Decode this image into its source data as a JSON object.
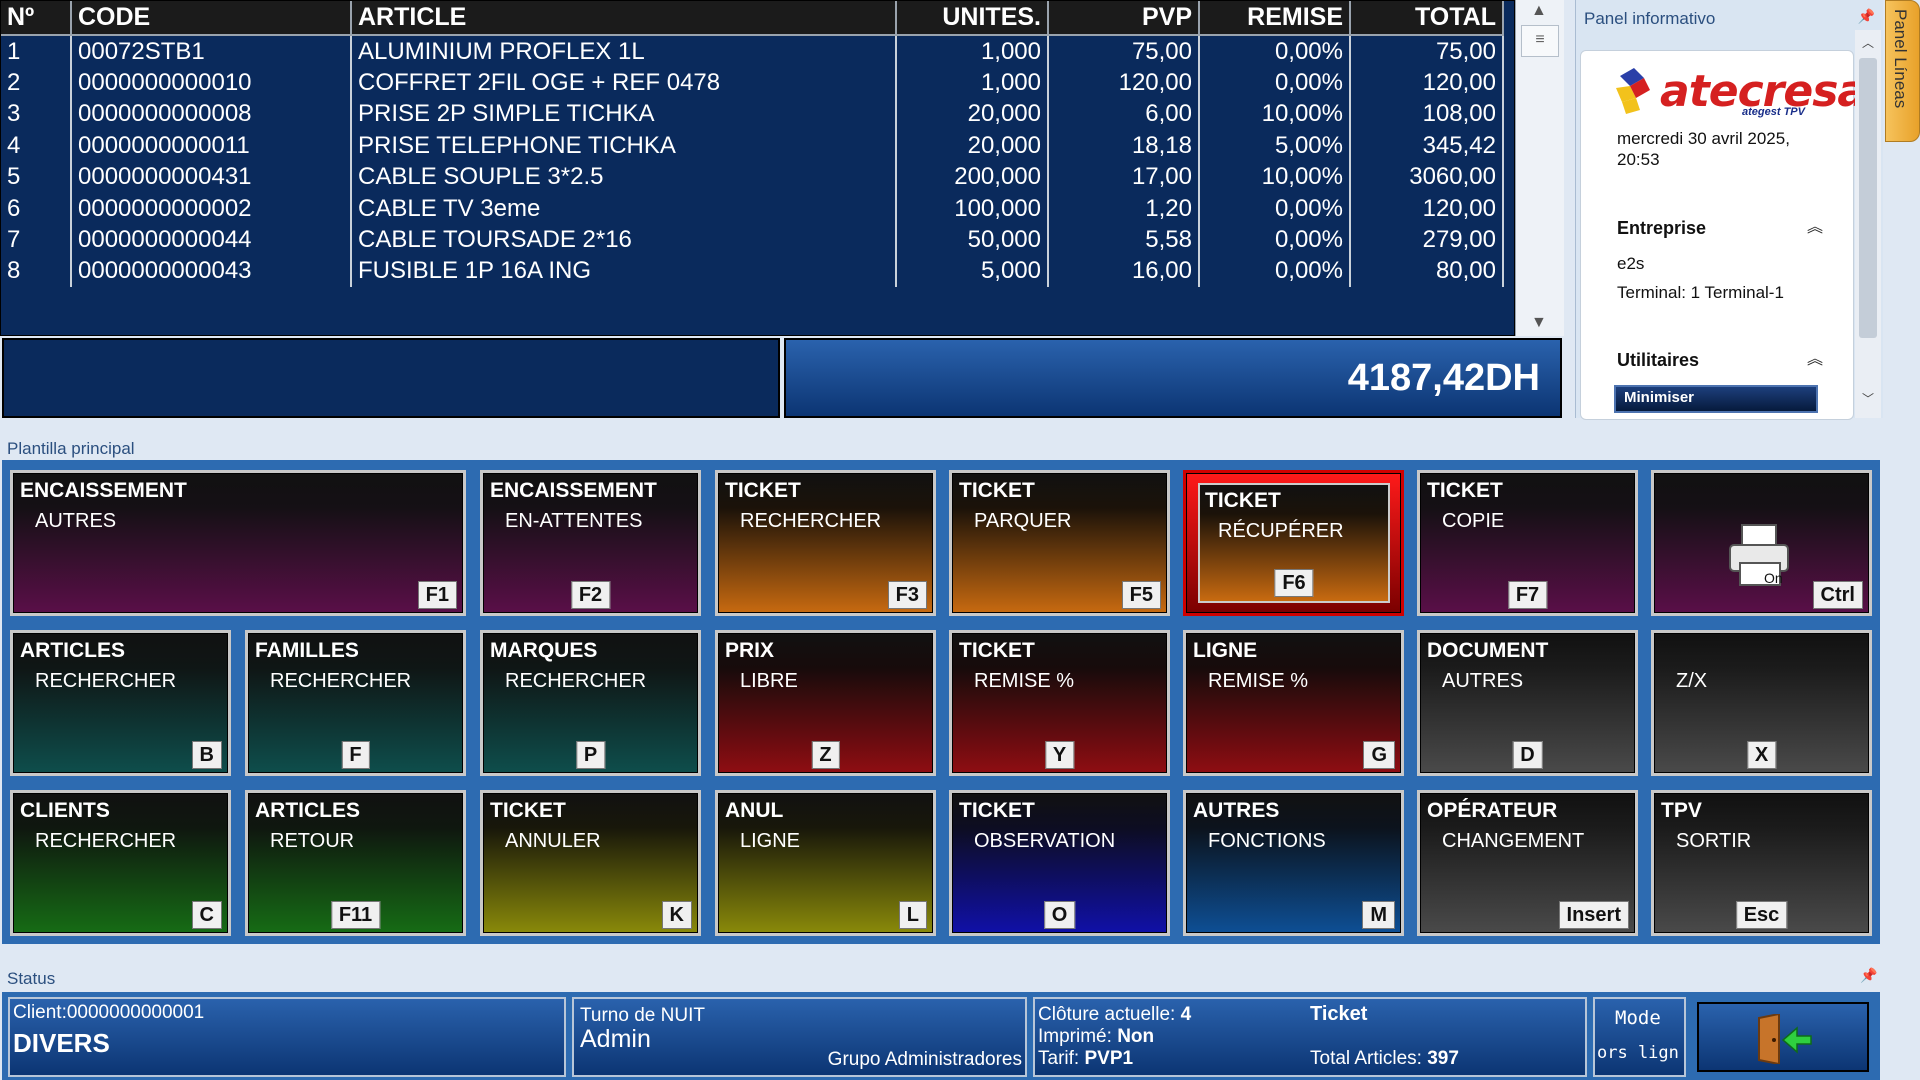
{
  "grid": {
    "columns": [
      "Nº",
      "CODE",
      "ARTICLE",
      "UNITES.",
      "PVP",
      "REMISE",
      "TOTAL"
    ],
    "rows": [
      [
        "1",
        "00072STB1",
        "ALUMINIUM PROFLEX 1L",
        "1,000",
        "75,00",
        "0,00%",
        "75,00"
      ],
      [
        "2",
        "0000000000010",
        "COFFRET 2FIL OGE    + REF 0478",
        "1,000",
        "120,00",
        "0,00%",
        "120,00"
      ],
      [
        "3",
        "0000000000008",
        "PRISE 2P SIMPLE TICHKA",
        "20,000",
        "6,00",
        "10,00%",
        "108,00"
      ],
      [
        "4",
        "0000000000011",
        "PRISE TELEPHONE TICHKA",
        "20,000",
        "18,18",
        "5,00%",
        "345,42"
      ],
      [
        "5",
        "0000000000431",
        "CABLE SOUPLE 3*2.5",
        "200,000",
        "17,00",
        "10,00%",
        "3060,00"
      ],
      [
        "6",
        "0000000000002",
        "CABLE TV 3eme",
        "100,000",
        "1,20",
        "0,00%",
        "120,00"
      ],
      [
        "7",
        "0000000000044",
        "CABLE TOURSADE 2*16",
        "50,000",
        "5,58",
        "0,00%",
        "279,00"
      ],
      [
        "8",
        "0000000000043",
        "FUSIBLE 1P 16A ING",
        "5,000",
        "16,00",
        "0,00%",
        "80,00"
      ]
    ],
    "total": "4187,42DH"
  },
  "info_panel": {
    "title": "Panel informativo",
    "side_tab": "Panel Líneas",
    "logo": "atecresa",
    "logo_sub": "ategest TPV",
    "date": "mercredi 30 avril 2025, 20:53",
    "entreprise_label": "Entreprise",
    "entreprise_value": "e2s",
    "terminal": "Terminal: 1 Terminal-1",
    "utilitaires_label": "Utilitaires",
    "minimize_label": "Minimiser"
  },
  "plantilla": {
    "title": "Plantilla principal",
    "buttons": [
      {
        "l1": "ENCAISSEMENT",
        "l2": "AUTRES",
        "key": "F1"
      },
      {
        "l1": "ENCAISSEMENT",
        "l2": "EN-ATTENTES",
        "key": "F2"
      },
      {
        "l1": "TICKET",
        "l2": "RECHERCHER",
        "key": "F3"
      },
      {
        "l1": "TICKET",
        "l2": "PARQUER",
        "key": "F5"
      },
      {
        "l1": "TICKET",
        "l2": "RÉCUPÉRER",
        "key": "F6"
      },
      {
        "l1": "TICKET",
        "l2": "COPIE",
        "key": "F7"
      },
      {
        "l1": "",
        "l2": "",
        "key": "Ctrl",
        "icon": "printer-icon"
      },
      {
        "l1": "ARTICLES",
        "l2": "RECHERCHER",
        "key": "B"
      },
      {
        "l1": "FAMILLES",
        "l2": "RECHERCHER",
        "key": "F"
      },
      {
        "l1": "MARQUES",
        "l2": "RECHERCHER",
        "key": "P"
      },
      {
        "l1": "PRIX",
        "l2": "LIBRE",
        "key": "Z"
      },
      {
        "l1": "TICKET",
        "l2": "REMISE %",
        "key": "Y"
      },
      {
        "l1": "LIGNE",
        "l2": "REMISE %",
        "key": "G"
      },
      {
        "l1": "DOCUMENT",
        "l2": "AUTRES",
        "key": "D"
      },
      {
        "l1": "",
        "l2": "Z/X",
        "key": "X"
      },
      {
        "l1": "CLIENTS",
        "l2": "RECHERCHER",
        "key": "C"
      },
      {
        "l1": "ARTICLES",
        "l2": "RETOUR",
        "key": "F11"
      },
      {
        "l1": "TICKET",
        "l2": "ANNULER",
        "key": "K"
      },
      {
        "l1": "ANUL",
        "l2": "LIGNE",
        "key": "L"
      },
      {
        "l1": "TICKET",
        "l2": "OBSERVATION",
        "key": "O"
      },
      {
        "l1": "AUTRES",
        "l2": "FONCTIONS",
        "key": "M"
      },
      {
        "l1": "OPÉRATEUR",
        "l2": "CHANGEMENT",
        "key": "Insert"
      },
      {
        "l1": "TPV",
        "l2": "SORTIR",
        "key": "Esc"
      }
    ]
  },
  "status": {
    "title": "Status",
    "client_label": "Client:0000000000001",
    "client_name": "DIVERS",
    "turno": "Turno de NUIT",
    "user": "Admin",
    "group": "Grupo Administradores",
    "cloture_label": "Clôture actuelle:",
    "cloture_value": "4",
    "imprime_label": "Imprimé:",
    "imprime_value": "Non",
    "tarif_label": "Tarif:",
    "tarif_value": "PVP1",
    "ticket_label": "Ticket",
    "total_articles_label": "Total Articles:",
    "total_articles_value": "397",
    "mode_label": "Mode",
    "mode_value": "ors lign"
  },
  "colors": {
    "grid_bg": "#0a2a5c",
    "panel_blue": "#2d6bb1",
    "selected_button": "#ff1a1a"
  }
}
